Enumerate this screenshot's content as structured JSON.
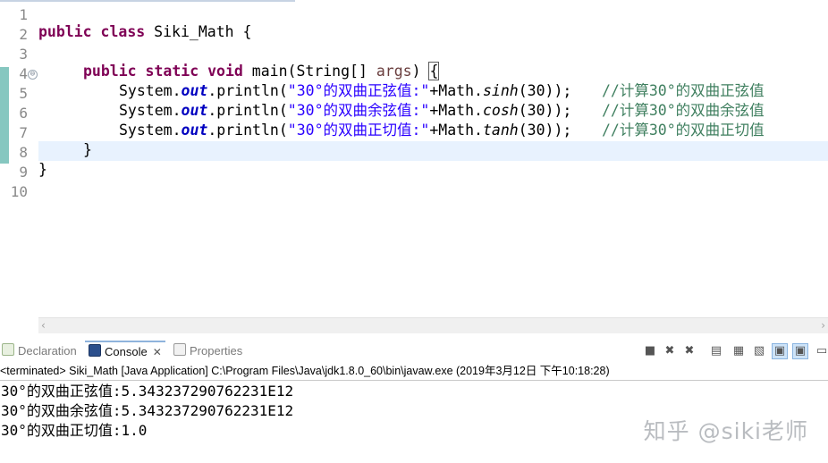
{
  "editor": {
    "line_numbers": [
      "1",
      "2",
      "3",
      "4",
      "5",
      "6",
      "7",
      "8",
      "9",
      "10"
    ],
    "fold_icon": "⊖",
    "line2": {
      "kw1": "public",
      "kw2": "class",
      "rest": " Siki_Math {"
    },
    "line4": {
      "kw1": "public",
      "kw2": "static",
      "kw3": "void",
      "name": " main(String[] ",
      "param": "args",
      "close": ") ",
      "brace": "{"
    },
    "line5": {
      "sys": "System.",
      "out": "out",
      "println": ".println(",
      "str": "\"30°的双曲正弦值:\"",
      "plus": "+Math.",
      "fn": "sinh",
      "args": "(30));",
      "comment": "//计算30°的双曲正弦值"
    },
    "line6": {
      "sys": "System.",
      "out": "out",
      "println": ".println(",
      "str": "\"30°的双曲余弦值:\"",
      "plus": "+Math.",
      "fn": "cosh",
      "args": "(30));",
      "comment": "//计算30°的双曲余弦值"
    },
    "line7": {
      "sys": "System.",
      "out": "out",
      "println": ".println(",
      "str": "\"30°的双曲正切值:\"",
      "plus": "+Math.",
      "fn": "tanh",
      "args": "(30));",
      "comment": "//计算30°的双曲正切值"
    },
    "line8": "}",
    "line9": "}"
  },
  "scrollbar": {
    "left_arrow": "‹",
    "right_arrow": "›"
  },
  "views": {
    "tabs": [
      {
        "label": "Declaration",
        "icon": "declaration-icon"
      },
      {
        "label": "Console",
        "icon": "console-icon",
        "close": "✕"
      },
      {
        "label": "Properties",
        "icon": "properties-icon"
      }
    ]
  },
  "console": {
    "status": "<terminated> Siki_Math [Java Application] C:\\Program Files\\Java\\jdk1.8.0_60\\bin\\javaw.exe (2019年3月12日 下午10:18:28)",
    "output": [
      "30°的双曲正弦值:5.343237290762231E12",
      "30°的双曲余弦值:5.343237290762231E12",
      "30°的双曲正切值:1.0"
    ]
  },
  "watermark": "知乎 @siki老师",
  "colors": {
    "keyword": "#7f0055",
    "string": "#2a00ff",
    "comment": "#3f7f5f",
    "field": "#0000c0",
    "current_line": "#e8f2fe"
  }
}
